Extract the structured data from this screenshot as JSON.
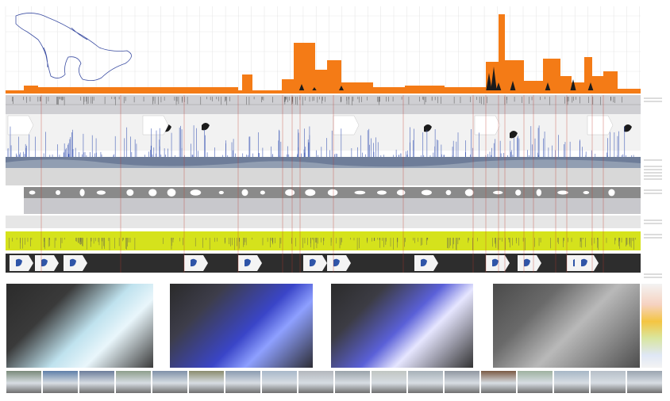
{
  "board": {
    "background": "#ffffff",
    "colors": {
      "orange": "#f47b16",
      "lime": "#d5e21c",
      "band_gray": "#cfcfd3",
      "dark_band": "#2d2d2d",
      "blue_spikes": "#4660b8",
      "red_lines": "#c0392b"
    }
  },
  "rows": [
    {
      "name": "great-lakes-outline-and-orange-histogram"
    },
    {
      "name": "gray-tick-band"
    },
    {
      "name": "lake-map-markers-band"
    },
    {
      "name": "blue-spike-band"
    },
    {
      "name": "terrain-profile-band"
    },
    {
      "name": "white-shapes-band"
    },
    {
      "name": "gray-data-band"
    },
    {
      "name": "yellow-band"
    },
    {
      "name": "dark-michigan-icons-band"
    }
  ],
  "photos": [
    {
      "name": "model-ice-white",
      "tone": "#cfe9f3"
    },
    {
      "name": "model-blue-night",
      "tone": "#3a45c8"
    },
    {
      "name": "model-blue-white",
      "tone": "#5a60d8"
    },
    {
      "name": "model-gray",
      "tone": "#9a9a9a"
    }
  ],
  "thumbnails": [
    {
      "name": "thumb-1",
      "tone": "#7a8a7a"
    },
    {
      "name": "thumb-2",
      "tone": "#5f7fa8"
    },
    {
      "name": "thumb-3",
      "tone": "#6c7d9a"
    },
    {
      "name": "thumb-4",
      "tone": "#8e9f8c"
    },
    {
      "name": "thumb-5",
      "tone": "#7f90a8"
    },
    {
      "name": "thumb-6",
      "tone": "#8a8c6e"
    },
    {
      "name": "thumb-7",
      "tone": "#8b9bb0"
    },
    {
      "name": "thumb-8",
      "tone": "#a9b8c9"
    },
    {
      "name": "thumb-9",
      "tone": "#b3b7bd"
    },
    {
      "name": "thumb-10",
      "tone": "#9aa3aa"
    },
    {
      "name": "thumb-11",
      "tone": "#c0c5c2"
    },
    {
      "name": "thumb-12",
      "tone": "#a7b1b8"
    },
    {
      "name": "thumb-13",
      "tone": "#8f96a0"
    },
    {
      "name": "thumb-14",
      "tone": "#7b5a44"
    },
    {
      "name": "thumb-15",
      "tone": "#9fb2a0"
    },
    {
      "name": "thumb-16",
      "tone": "#a7b7c6"
    },
    {
      "name": "thumb-17",
      "tone": "#b7bfc8"
    },
    {
      "name": "thumb-18",
      "tone": "#9ba5b0"
    }
  ]
}
